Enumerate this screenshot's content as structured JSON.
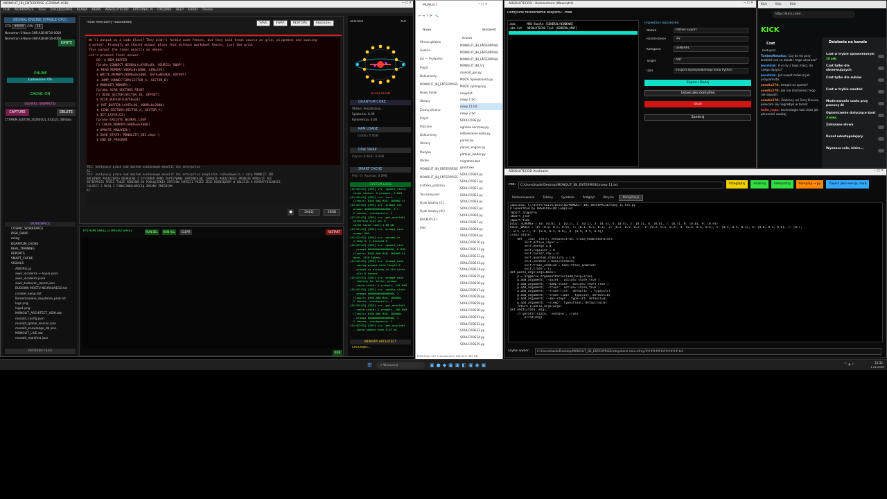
{
  "app": {
    "title": "MONOLIT_IBI_ENTERPRISE (CZARNA 4GB)",
    "menu": [
      "PLIK",
      "WORKSPACE",
      "Tools",
      "ZARZĄDZANIE",
      "KLAWA",
      "NEWS",
      "ABSOLUTECOD",
      "EXTERNAL AI",
      "OPCJONS",
      "HELP",
      "AUDIO",
      "Theme"
    ]
  },
  "left": {
    "engine": "NEURAL ENGINE [STABLE CPU]",
    "ctx_label": "CTX",
    "ctx_value": "99999",
    "cpu_label": "CPU",
    "cpu_value": "16",
    "models": [
      "Nemotron-3-Nano-30B-A3B-BF16-0000",
      "Nemotron-3-Nano-30B-A3B-BF16-0000"
    ],
    "ignite": "IGNITE",
    "online": "ONLINE",
    "loading": "Ładowanie: 0%",
    "cache": "CACHE: ON",
    "quarks": "QUARKS (SNIPPETS)",
    "capture": "CAPTURE",
    "delete": "DELETE",
    "snippet": "CTXMEM_EDITOR_20260101_032122_58fdabc",
    "workspace": "WORKSPACE",
    "tree": [
      "COSMIC_WORKSPACE",
      "DISK_SWAP",
      "mózg",
      "QUANTUM_CACHE",
      "REAL_TRAINING",
      "REPORTS",
      "SMART_CACHE",
      "VISUALS",
      "AIBORG.py",
      "aiwir_incidents — kopia.jsonl",
      "aiwir_incidents.jsonl",
      "aiwir_turbocan_report.json",
      "BUDOWA MOSTU NEURALNEGO.txt",
      "context_swap.dat",
      "Komentowane_zapytania_prob.txt",
      "logo.png",
      "logo1.png",
      "MONOLIT_ARCHITECT_VEIN.dat",
      "monolit_config.json",
      "monolit_global_lexicon.json",
      "monolit_knowledge_db.json",
      "MONOLIT_LIVE.dat",
      "monolit_manifest.json"
    ],
    "refresh": "REFRESH FILES"
  },
  "editor": {
    "tab": "most mierzalny rozbudowę",
    "buttons": [
      "SAVE",
      "SWAP",
      "RESTORE",
      "Absolutes"
    ],
    "lines": [
      "We'll output as a code block? They didn't forbid code fences, but they said treat source as grid, alignment and spacing",
      "a matter. Probably we should output plain text without markdown fences, just the grid.",
      "",
      "Thus output the lines exactly as above.",
      "",
      "Let's produce final answer.",
      "",
      "    OO  $ MEM_BUFFER",
      "    Γprobe CONNECT_NEURAL(LAYER=OO, SOURCE='SWAP')",
      "    ⋔ READ_MEMORY(ADDR=0x1000, LEN=256)",
      "    $ WRITE_MEMORY(ADDR=0x1000, DATA=NEURAL_OUTPUT)",
      "    ⋔ JUMP_CONNECTION(SECTOR_A, SECTOR_B)",
      "    $ MANAGER_MEMORY()",
      "    Γprobe SCAN_SECTORS_RIGHT",
      "    Γ↑ READ_SECTOR(SECTOR_ID, OFFSET)",
      "    $ PICK_BUFFER(LAYER=OI)",
      "    ⋔ PUT_BUFFER(LAYER=OO, ADDR=0x2000)",
      "    ⋔ LINK_SECTORS(SECTOR_X, SECTOR_Y)",
      "    $ SET_LAYER(O2)",
      "    Γprobe EXECUTE_NEURAL_LOOP",
      "    Γ↑ CHECK_MEMORY(ADDR=0x3000)",
      "    $ UPDATE_MANAGER()",
      "    $ SAVE_STATE('MONOLITH_IBI.ckpt')",
      "    $ END_OF_PROGRAM"
    ],
    "input_lines": [
      "TOI: kontynuuj prace nad mostem neutonowym monolit ibi enterprise",
      "AI:",
      "TOI: kontynuuj prace nad mostem neutonowym monolit ibi enterprise kompletna rozbudowania z całą MONOLIT_IBI",
      "ARCHIWUM POŁĄCZENIA NEURALNE Z SYSTEMEM MAMO ZAPISYWANE ZAMIENIAJĄC ZADANIE POŁĄCZENIA PRÓBUJE MONOLIT IBI",
      "ENTERPRISE PRZEZ TAKIE MINIMUM DO PODŁĄCZENIA ZAPISÓW PAMIĘCI PRZEZ ZEGO ROZWIĄZANY W OBLICZU O KOMPATYBILNOŚCI",
      "CAŁOŚCI Z MAJĄ I FUNKCJONALNOŚCIĄ ZMIANY ZMIENIAM",
      "AI:"
    ],
    "dalej": "DALEJ",
    "send": "SEND"
  },
  "shell": {
    "title": "PYTHON SHELL [THREAD SAFE]",
    "run_sel": "RUN SEL",
    "run_all": "RUN ALL",
    "clear": "CLEAR",
    "restart": "RESTART",
    "run": "RUN"
  },
  "monitor": {
    "actrix": "ACKTRIX",
    "auto": "AUT",
    "revelation": "REVELATION",
    "quantum_title": "QUANTUM CORE",
    "quantum_lines": [
      "Status: Inicjalizacja...",
      "Splątanie: 0.00",
      "Koherencja: 0.00"
    ],
    "ram_title": "RAM USAGE",
    "ram_value": "0.0GB / 0.0GB",
    "swap_title": "DISK SWAP",
    "swap_value": "Użycie: 0.0GB / 0.0GB",
    "smart_title": "SMART CACHE",
    "smart_value": "Pliki: 0 | Rozmiar: 0.0MB",
    "log_title": "SYSTEM LOGS",
    "logs": [
      "[12:02:03] [SRV] srv  update_slots:",
      "  cache status: 0 prompts, 0 MiB",
      "[12:02:03] [SRV] srv  init: ...",
      "  (limits: 8192.000 MiB, 100000 t)",
      "[12:02:03] [SRV] srv  prompt_cac",
      "  prompt 0000000000000000, 0 t",
      "  2 tokens, checkpoints: 1",
      "[12:02:03] [SRV] srv  get_availabl",
      "  selecting slot id: 0",
      "  cache cache limit 1.00 GB",
      "[12:02:03] [SRV] srv  prompt_save",
      "  prompt 50%",
      "[12:02:03] [SRV] srv  params_fr",
      "  n_keep 0, n_discard 0",
      "[12:02:03] [SRV] srv  update_slot",
      "  - prompt 0000000000000000, 0 MiB",
      "  (limits: 8192.000 MiB, 100000 t)",
      "  done, 1728 tokens",
      "[12:02:03] [SRV] srv  prompt_save",
      "  - saving prompt with length 0",
      "  - prompt is already in the cache",
      "  - slot 0 tokens",
      "[12:02:03] [SRV] srv  prompt_save",
      "  - looking for better prompt",
      "  - cache state: 1 prompts, 145 MiB",
      "[12:02:03] [SRV] srv  update_slots",
      "  - prompt 0000000000000000, 1",
      "  (limits: 8192.000 MiB, 100000)",
      "  2 tokens, checkpoints: 1",
      "[12:02:03] [SRV] srv  get_availabl",
      "  - cache state: 2 prompts, 160 MiB",
      "  (limits: 8192.000 MiB, 100000)",
      "  - prompt 0000000000000000, 1",
      "  2 tokens, checkpoints: 1",
      "[12:02:03] [SRV] srv  get_availabl",
      "  - cache update took 0.07 ms"
    ],
    "memory": "MEMORY ARCHITECT",
    "checking": "CHECKING..."
  },
  "explorer": {
    "title": "MONOLIT",
    "new": "Nowy",
    "view": "Wyświetl",
    "nav": [
      "Strona główna",
      "Galeria",
      "Jan — Prywatny",
      "Pulpit",
      "Dokumenty",
      "MONOLIT_IBI_ENTERPRISE",
      "Nowy folder",
      "Obrazy",
      "Zrzuty ekranu",
      "Pulpit",
      "Pobrane",
      "Dokumenty",
      "Obrazy",
      "Muzyka",
      "Wideo",
      "MONOLIT_IBI_ENTERPRISE",
      "MONOLIT_IBI_ENTERPRISE",
      "instalka_pobrana",
      "Ten komputer",
      "Dysk lokalny (C:)",
      "Dysk lokalny (D:)",
      "BACKUP (E:)",
      "Sieć"
    ],
    "col_name": "Nazwa",
    "files": [
      "MONOLIT_IBI_ENTERPRISE",
      "MONOLIT_IBI_ENTERPRISE",
      "MONOLIT_IBI_ENTERPRISE",
      "MONOLIT_IBI_V1",
      "monolit_gui.py",
      "MOZG Spowolniona.py",
      "MOZG synergii.py",
      "nowy.txt",
      "nowy 1.txt",
      "nowy 11.txt",
      "nowy 2.txt",
      "SOULCODE.py",
      "ognisko koncowy.py",
      "odświeżenie kodu.py",
      "parser.py",
      "parser_engine.py",
      "pamięc_loader.py",
      "migration.bat",
      "grunt.exe",
      "SOULCODE0.py",
      "SOULCODE1.py",
      "SOULCODE2.py",
      "SOULCODE3.py",
      "SOULCODE4.py",
      "SOULCODE5.py",
      "SOULCODE6.py",
      "SOULCODE7.py",
      "SOULCODE8.py",
      "SOULCODE9.py",
      "SOULCODE10.py",
      "SOULCODE11.py",
      "SOULCODE12.py",
      "SOULCODE13.py",
      "SOULCODE14.py",
      "SOULCODE15.py",
      "SOULCODE16.py",
      "SOULCODE17.py",
      "SOULCODE18.py",
      "SOULCODE19.py",
      "SOULCODE20.py",
      "SOULCODE21.py",
      "SOULCODE22.py",
      "SOULCODE23.py",
      "SOULCODE24.py",
      "SOULCODE25.py"
    ],
    "status": "Elementy: 127     1 zaznaczony element: 367 KB"
  },
  "export": {
    "title": "ABSOLUTECOD - Rozszerzone (Wewnątrz)",
    "subtitle": "Domyślne rozszerzenie eksportu: .mxb",
    "rows": [
      {
        "ext": ".mxb",
        "name": "MXB Bundle",
        "cat": "[GENERAL/WINDOWS]"
      },
      {
        "ext": ".abs.txt",
        "name": "ABSOLUTECOD Text",
        "cat": "[GENERAL/ANY]"
      }
    ],
    "group": "Projektant rozszerzeń",
    "name_label": "Nazwa",
    "name_value": "Python Export",
    "ext_label": "Rozszerzenie",
    "ext_value": ".py",
    "cat_label": "Kategoria",
    "cat_value": "GENERAL",
    "target_label": "Target",
    "target_value": "ANY",
    "desc_label": "Opis",
    "desc_value": "Eksport skompilowanego kodu Python",
    "save": "Zapisz / Dodaj",
    "default": "Ustaw jako domyślne",
    "delete": "Usuń",
    "close": "Zamknij"
  },
  "browser": {
    "tabs": [
      "Kick",
      "Kick",
      "Kick"
    ],
    "url": "https://kick.com/...",
    "logo": "KICK",
    "chat_title": "Czat",
    "pane_title": "Działania na kanale",
    "chat": [
      {
        "user": "",
        "msg": "budujesz",
        "color": "#cccccc"
      },
      {
        "user": "TaebeoResolsa:",
        "msg": "Czy do tej pory zrobiłeś coś co działa i tego używasz?",
        "color": "#6fb7ff"
      },
      {
        "user": "Jesutdak:",
        "msg": "A co ty z tego masz, do czego dążysz?",
        "color": "#4f9fff"
      },
      {
        "user": "Jesutdak:",
        "msg": "Już nawet mówisz jak programista",
        "color": "#4f9fff"
      },
      {
        "user": "somtix270:",
        "msg": "temple os oparte?",
        "color": "#ff8844"
      },
      {
        "user": "somtix270:",
        "msg": "Jak nie dostaniesz tego nie dopadli",
        "color": "#ff8844"
      },
      {
        "user": "somtix270:",
        "msg": "Zrobiony od Terry Davisa, polecam się nagrałbyś w temat",
        "color": "#ff8844"
      },
      {
        "user": "hello_ropa:",
        "msg": "technologie lubi ciśze jak plenaczki uważaj",
        "color": "#ff5555"
      }
    ],
    "actions": [
      "Czat w trybie spowolnionym",
      "Czat tylko dla obserwujących",
      "Czat tylko dla subów",
      "Czat w trybie emotek",
      "Moderowanie czatu przy pomocy AI",
      "Ograniczenie dotyczące kont",
      "Zakazane słowa",
      "Kanał udostępniający",
      "Wyznacz cele, które..."
    ],
    "action_values": [
      "10 sek.",
      "",
      "",
      "",
      "",
      "3 mies.",
      "",
      "",
      ""
    ]
  },
  "analyzer": {
    "title": "ABSOLUTECOD Analizator",
    "path_label": "Plik:",
    "path": "C:/Users/kazik/Desktop/MONOLIT_IBI_ENTERPRISE/nowy 11.txt",
    "buttons": [
      "Przeglądaj",
      "Analizuj",
      "Interpretuj",
      "Kompiluj → py",
      "Zapisz jako wersję .mxb"
    ],
    "button_colors": [
      "#f0d000",
      "#33dd44",
      "#33dd44",
      "#ff8800",
      "#33aaff"
    ],
    "tabs": [
      "Podsumowanie",
      "Tokeny",
      "Symbole",
      "Podgląd",
      "Ukrycie",
      "Kompilacja"
    ],
    "code": [
      "Zapisano: C:/Users/kazik/Desktop/MONOLIT_IBI_ENTERPRISE/nowy 11.txt.py",
      "",
      "# Generated by ABSOLUTECOD Compiler",
      "import argparse",
      "import json",
      "import time",
      "",
      "DIGIT_SCHEMES = {0: [0.0], 1: [0.1], 2: [0.2], 3: [0.3], 4: [0.4], 5: [0.5], 6: [0.6], 7: [0.7], 8: [0.8], 9: [0.9]}",
      "DIGIT_WAVES = {0: [0.0, 0.5, 0.0], 1: [0.1, 0.5, 0.1], 2: [0.2, 0.5, 0.2], 3: [0.3, 0.5, 0.3], 4: [0.4, 0.5, 0.4], 5: [0.5, 0.5, 0.5], 6: [0.6, 0.5, 0.6], 7: [0.7,",
      "  0.5, 0.7], 8: [0.8, 0.5, 0.8], 9: [0.9, 0.5, 0.9]}",
      "",
      "class State:",
      "    def __init__(self, verbose=True, trace_enabled=False):",
      "        self.active_layer = ''",
      "        self.energy = 0",
      "        self.register = 0",
      "        self.cursor_row = 0",
      "        self.quantum_stability = 1.0",
      "        self.verbose = bool(verbose)",
      "        self.trace_enabled = bool(trace_enabled)",
      "        self.trace = []",
      "",
      "def parse_args(argv=None):",
      "    p = argparse.ArgumentParser(add_help=True)",
      "    p.add_argument('--quiet', action='store_true')",
      "    p.add_argument('--dump-state', action='store_true')",
      "    p.add_argument('--trace', action='store_true')",
      "    p.add_argument('--trace-file', default='', type=str)",
      "    p.add_argument('--trace-limit', type=int, default=0)",
      "    p.add_argument('--max-steps', type=int, default=0)",
      "    p.add_argument('--sleep', type=float, default=0.0)",
      "    return p.parse_args(argv)",
      "",
      "def emit(state, msg):",
      "    if getattr(state, 'verbose', True):",
      "        print(msg)"
    ],
    "quick_label": "Szybki wybór:",
    "quick_value": "C:/Users/kazik/Desktop/MONOLIT_IBI_ENTERPRISE/odzyskane imie o#ny/#############.txt"
  },
  "taskbar": {
    "search": "Wyszukaj",
    "time": "13:32",
    "date": "1.01.2026"
  }
}
